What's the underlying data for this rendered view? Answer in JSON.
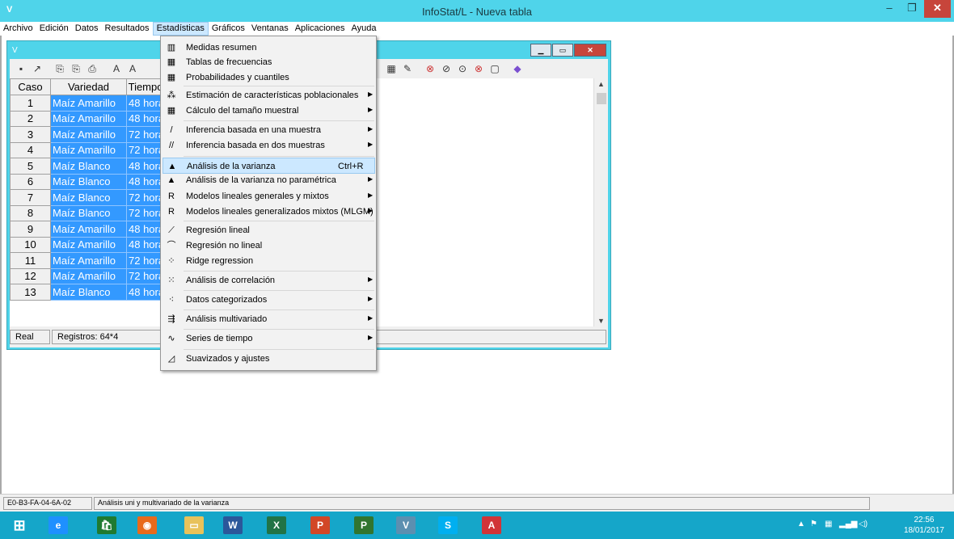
{
  "window": {
    "title": "InfoStat/L - Nueva tabla",
    "min_glyph": "–",
    "max_glyph": "❐",
    "close_glyph": "✕"
  },
  "menubar": [
    "Archivo",
    "Edición",
    "Datos",
    "Resultados",
    "Estadísticas",
    "Gráficos",
    "Ventanas",
    "Aplicaciones",
    "Ayuda"
  ],
  "menubar_active": "Estadísticas",
  "grid": {
    "headers": [
      "Caso",
      "Variedad",
      "Tiempo"
    ],
    "rows": [
      [
        "1",
        "Maíz Amarillo",
        "48 hora"
      ],
      [
        "2",
        "Maíz Amarillo",
        "48 hora"
      ],
      [
        "3",
        "Maíz Amarillo",
        "72 hora"
      ],
      [
        "4",
        "Maíz Amarillo",
        "72 hora"
      ],
      [
        "5",
        "Maíz Blanco",
        "48 hora"
      ],
      [
        "6",
        "Maíz Blanco",
        "48 hora"
      ],
      [
        "7",
        "Maíz Blanco",
        "72 hora"
      ],
      [
        "8",
        "Maíz Blanco",
        "72 hora"
      ],
      [
        "9",
        "Maíz Amarillo",
        "48 hora"
      ],
      [
        "10",
        "Maíz Amarillo",
        "48 hora"
      ],
      [
        "11",
        "Maíz Amarillo",
        "72 hora"
      ],
      [
        "12",
        "Maíz Amarillo",
        "72 hora"
      ],
      [
        "13",
        "Maíz Blanco",
        "48 hora"
      ]
    ]
  },
  "child_status": {
    "mode": "Real",
    "records": "Registros: 64*4"
  },
  "dropdown": [
    {
      "label": "Medidas resumen",
      "icon": "summary-icon",
      "glyph": "▥",
      "arrow": false
    },
    {
      "label": "Tablas de frecuencias",
      "icon": "frequency-table-icon",
      "glyph": "▦",
      "arrow": false
    },
    {
      "label": "Probabilidades y cuantiles",
      "icon": "calculator-icon",
      "glyph": "▦",
      "arrow": false
    },
    {
      "label": "Estimación de características poblacionales",
      "icon": "population-icon",
      "glyph": "⁂",
      "arrow": true
    },
    {
      "label": "Cálculo del tamaño muestral",
      "icon": "sample-size-icon",
      "glyph": "▦",
      "arrow": true
    },
    {
      "label": "Inferencia basada en una muestra",
      "icon": "one-sample-icon",
      "glyph": "/",
      "arrow": true
    },
    {
      "label": "Inferencia basada en dos muestras",
      "icon": "two-sample-icon",
      "glyph": "//",
      "arrow": true
    },
    {
      "label": "Análisis de la varianza",
      "icon": "anova-icon",
      "glyph": "▲",
      "shortcut": "Ctrl+R",
      "arrow": false,
      "highlight": true
    },
    {
      "label": "Análisis de la varianza no paramétrica",
      "icon": "nonparametric-anova-icon",
      "glyph": "▲",
      "arrow": true
    },
    {
      "label": "Modelos lineales generales y mixtos",
      "icon": "r-icon",
      "glyph": "R",
      "arrow": true
    },
    {
      "label": "Modelos lineales generalizados mixtos (MLGM)",
      "icon": "r-icon",
      "glyph": "R",
      "arrow": true
    },
    {
      "label": "Regresión lineal",
      "icon": "linear-regression-icon",
      "glyph": "⟋",
      "arrow": false
    },
    {
      "label": "Regresión no lineal",
      "icon": "nonlinear-regression-icon",
      "glyph": "⌒",
      "arrow": false
    },
    {
      "label": "Ridge regression",
      "icon": "ridge-regression-icon",
      "glyph": "⁘",
      "arrow": false
    },
    {
      "label": "Análisis de correlación",
      "icon": "correlation-icon",
      "glyph": "⁙",
      "arrow": true
    },
    {
      "label": "Datos categorizados",
      "icon": "categorical-icon",
      "glyph": "⁖",
      "arrow": true
    },
    {
      "label": "Análisis multivariado",
      "icon": "multivariate-icon",
      "glyph": "⇶",
      "arrow": true
    },
    {
      "label": "Series de tiempo",
      "icon": "time-series-icon",
      "glyph": "∿",
      "arrow": true
    },
    {
      "label": "Suavizados y ajustes",
      "icon": "smoothing-icon",
      "glyph": "◿",
      "arrow": false
    }
  ],
  "main_status": {
    "code": "E0-B3-FA-04-6A-02",
    "hint": "Análisis uni y multivariado de la varianza"
  },
  "taskbar": {
    "apps": [
      {
        "name": "start",
        "glyph": "⊞",
        "color": "#ffffff"
      },
      {
        "name": "internet-explorer",
        "glyph": "e",
        "color": "#1e90ff"
      },
      {
        "name": "store",
        "glyph": "🛍",
        "color": "#1f7a30"
      },
      {
        "name": "firefox",
        "glyph": "◉",
        "color": "#e86a1b"
      },
      {
        "name": "file-explorer",
        "glyph": "▭",
        "color": "#e8c25a"
      },
      {
        "name": "word",
        "glyph": "W",
        "color": "#2b579a"
      },
      {
        "name": "excel",
        "glyph": "X",
        "color": "#217346"
      },
      {
        "name": "powerpoint",
        "glyph": "P",
        "color": "#d24726"
      },
      {
        "name": "project",
        "glyph": "P",
        "color": "#31752f"
      },
      {
        "name": "infostat",
        "glyph": "V",
        "color": "#5c8fb0"
      },
      {
        "name": "skype",
        "glyph": "S",
        "color": "#00aff0"
      },
      {
        "name": "acrobat",
        "glyph": "A",
        "color": "#d13438"
      }
    ],
    "tray_arrow": "▲",
    "time": "22:56",
    "date": "18/01/2017"
  }
}
